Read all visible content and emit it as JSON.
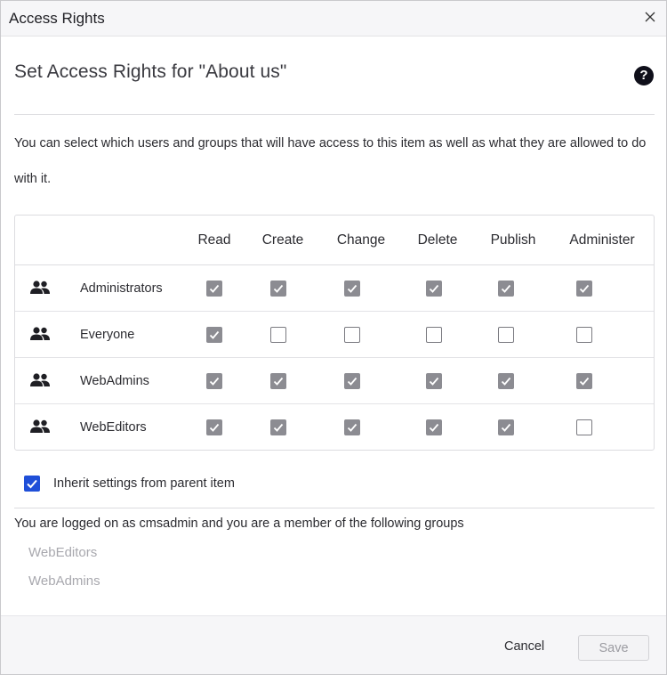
{
  "dialog": {
    "title": "Access Rights",
    "heading": "Set Access Rights for \"About us\"",
    "description": "You can select which users and groups that will have access to this item as well as what they are allowed to do with it."
  },
  "table": {
    "columns": [
      "Read",
      "Create",
      "Change",
      "Delete",
      "Publish",
      "Administer"
    ],
    "rows": [
      {
        "name": "Administrators",
        "icon": "group-icon",
        "values": [
          true,
          true,
          true,
          true,
          true,
          true
        ]
      },
      {
        "name": "Everyone",
        "icon": "group-icon",
        "values": [
          true,
          false,
          false,
          false,
          false,
          false
        ]
      },
      {
        "name": "WebAdmins",
        "icon": "group-icon",
        "values": [
          true,
          true,
          true,
          true,
          true,
          true
        ]
      },
      {
        "name": "WebEditors",
        "icon": "group-icon",
        "values": [
          true,
          true,
          true,
          true,
          true,
          false
        ]
      }
    ]
  },
  "inherit": {
    "label": "Inherit settings from parent item",
    "checked": true
  },
  "membership": {
    "text": "You are logged on as cmsadmin and you are a member of the following groups",
    "groups": [
      "WebEditors",
      "WebAdmins"
    ]
  },
  "footer": {
    "cancel_label": "Cancel",
    "save_label": "Save",
    "save_enabled": false
  },
  "colors": {
    "accent": "#1f4fd8",
    "checked_disabled": "#8c8c92",
    "help_icon": "#0f0f1a"
  }
}
